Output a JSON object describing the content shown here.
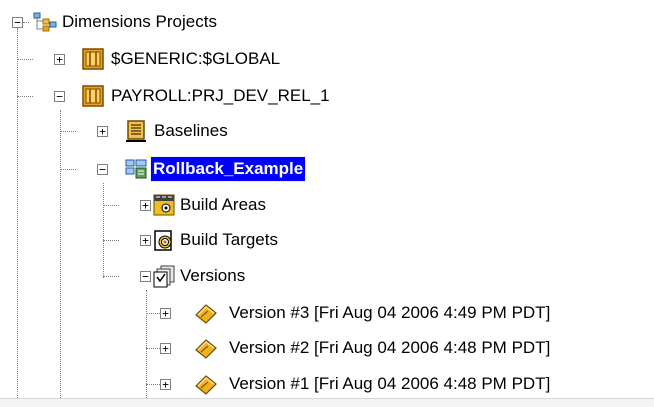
{
  "tree": {
    "root": {
      "label": "Dimensions Projects",
      "icon": "projects-folder-icon",
      "expanded": true
    },
    "items": [
      {
        "label": "$GENERIC:$GLOBAL",
        "icon": "project-icon",
        "expanded": false
      },
      {
        "label": "PAYROLL:PRJ_DEV_REL_1",
        "icon": "project-icon",
        "expanded": true
      },
      {
        "label": "Baselines",
        "icon": "baselines-icon",
        "expanded": false
      },
      {
        "label": "Rollback_Example",
        "icon": "stream-icon",
        "expanded": true,
        "selected": true
      },
      {
        "label": "Build Areas",
        "icon": "build-areas-icon",
        "expanded": false
      },
      {
        "label": "Build Targets",
        "icon": "build-targets-icon",
        "expanded": false
      },
      {
        "label": "Versions",
        "icon": "versions-icon",
        "expanded": true
      },
      {
        "label": "Version #3 [Fri Aug 04 2006 4:49 PM PDT]",
        "icon": "version-icon",
        "expanded": false
      },
      {
        "label": "Version #2 [Fri Aug 04 2006 4:48 PM PDT]",
        "icon": "version-icon",
        "expanded": false
      },
      {
        "label": "Version #1 [Fri Aug 04 2006 4:48 PM PDT]",
        "icon": "version-icon",
        "expanded": false
      }
    ]
  },
  "colors": {
    "selection_bg": "#0000ff",
    "selection_text": "#ffffff",
    "project_orange": "#f0a020",
    "version_gold": "#d4a017"
  },
  "toggle_glyphs": {
    "collapsed": "+",
    "expanded": "−"
  }
}
